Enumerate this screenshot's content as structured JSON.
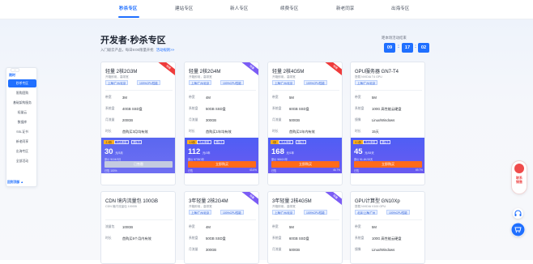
{
  "nav": {
    "tabs": [
      {
        "label": "秒杀专区",
        "active": true
      },
      {
        "label": "建站专区",
        "active": false
      },
      {
        "label": "新人专区",
        "active": false
      },
      {
        "label": "续费专区",
        "active": false
      },
      {
        "label": "新老同享",
        "active": false
      },
      {
        "label": "出海专区",
        "active": false
      }
    ]
  },
  "hero": {
    "title": "开发者·秒杀专区",
    "subtitle": "入门级云产品，每日9:00限量开抢",
    "link": "活动规则>>"
  },
  "countdown": {
    "label": "距本场活动结束",
    "h": "09",
    "m": "17",
    "s": "02"
  },
  "sidebar": {
    "dots": "···",
    "logo": "限时",
    "items": [
      "秒杀专区",
      "限购团购",
      "基础架构服务",
      "轻量云",
      "数据库",
      "SSL证书",
      "新老同享",
      "出海专区",
      "全部活动"
    ],
    "footer": "回到顶部 ▲"
  },
  "cards": [
    {
      "title": "轻量 2核2G3M",
      "desc": "开箱即用，高带宽",
      "chips": [
        "上海/广州/北京",
        "100%CPU性能"
      ],
      "ribbon": "特惠",
      "specs": [
        [
          "带宽",
          "3M"
        ],
        [
          "系统盘",
          "40GB SSD盘"
        ],
        [
          "月流量",
          "200GB"
        ],
        [
          "时长",
          "首购买3月均有效"
        ]
      ],
      "tags": [
        "2.3折",
        "个人专享",
        "限1个"
      ],
      "price": "30",
      "unit": "元/3月",
      "orig": "原价 ¥104/3月",
      "btn": "已售罄",
      "btn_disabled": true,
      "stock": "已售 100%",
      "stock_pct": ""
    },
    {
      "title": "轻量 2核2G4M",
      "desc": "开箱即用，高带宽",
      "chips": [
        "上海/广州/北京",
        "100%CPU性能"
      ],
      "ribbon": "限量",
      "specs": [
        [
          "带宽",
          "4M"
        ],
        [
          "系统盘",
          "50GB SSD盘"
        ],
        [
          "月流量",
          "300GB"
        ],
        [
          "时长",
          "首购买1年均有效"
        ]
      ],
      "tags": [
        "1.5折",
        "个人专享",
        "限1个"
      ],
      "price": "112",
      "unit": "元/1年",
      "orig": "原价 ¥735/1年",
      "btn": "立即购买",
      "btn_disabled": false,
      "stock": "已售",
      "stock_pct": "43.5%"
    },
    {
      "title": "轻量 2核4G5M",
      "desc": "开箱即用，高带宽",
      "chips": [
        "上海/广州/北京",
        "100%CPU性能"
      ],
      "ribbon": "特惠",
      "specs": [
        [
          "带宽",
          "5M"
        ],
        [
          "系统盘",
          "60GB SSD盘"
        ],
        [
          "月流量",
          "500GB"
        ],
        [
          "时长",
          "首购买1年内有效"
        ]
      ],
      "tags": [
        "2折",
        "个人专享",
        "限1个"
      ],
      "price": "168",
      "unit": "元/1年",
      "orig": "原价 ¥840/1年",
      "btn": "立即购买",
      "btn_disabled": false,
      "stock": "已售",
      "stock_pct": "46.7%"
    },
    {
      "title": "GPU服务器 GN7-T4",
      "desc": "搭载 NVIDIA T4 GPU",
      "chips": [
        "上海/广州/北京"
      ],
      "ribbon": "",
      "specs": [
        [
          "带宽",
          "5M"
        ],
        [
          "系统盘",
          "100G 高性能云硬盘"
        ],
        [
          "镜像",
          "Linux/Windows"
        ],
        [
          "时长",
          "15天"
        ]
      ],
      "tags": [
        "0.1折",
        "个人专享",
        "限1个"
      ],
      "price": "45",
      "unit": "元/15天",
      "orig": "原价 ¥1.4K/15天",
      "btn": "立即购买",
      "btn_disabled": false,
      "stock": "已售",
      "stock_pct": "69.7%"
    },
    {
      "title": "CDN 境内流量包 100GB",
      "desc": "CDN 境内流量包 100GB",
      "chips": [],
      "ribbon": "",
      "specs": [
        [
          "流量包",
          "100GB"
        ],
        [
          "时长",
          "首购买6个月内有效"
        ]
      ],
      "tags": [],
      "price": "",
      "unit": "",
      "orig": "",
      "btn": "",
      "btn_disabled": false,
      "stock": "",
      "stock_pct": ""
    },
    {
      "title": "3年轻量 2核2G4M",
      "desc": "开箱即用，高带宽",
      "chips": [
        "上海/广州/北京",
        "100%CPU性能"
      ],
      "ribbon": "限量",
      "specs": [
        [
          "带宽",
          "4M"
        ],
        [
          "系统盘",
          "50GB SSD盘"
        ],
        [
          "月流量",
          "300GB"
        ]
      ],
      "tags": [],
      "price": "",
      "unit": "",
      "orig": "",
      "btn": "",
      "btn_disabled": false,
      "stock": "",
      "stock_pct": ""
    },
    {
      "title": "3年轻量 2核4G5M",
      "desc": "开箱即用，高带宽",
      "chips": [
        "上海/广州/北京",
        "100%CPU性能"
      ],
      "ribbon": "限量",
      "specs": [
        [
          "带宽",
          "5M"
        ],
        [
          "系统盘",
          "60GB SSD盘"
        ],
        [
          "月流量",
          "500GB"
        ]
      ],
      "tags": [],
      "price": "",
      "unit": "",
      "orig": "",
      "btn": "",
      "btn_disabled": false,
      "stock": "",
      "stock_pct": ""
    },
    {
      "title": "GPU计算型 GN10Xp",
      "desc": "搭载 NVIDIA V100 GPU",
      "chips": [
        "北京/上海/广州",
        "100%CPU性能"
      ],
      "ribbon": "",
      "specs": [
        [
          "带宽",
          "5M"
        ],
        [
          "系统盘",
          "100G 高性能云硬盘"
        ],
        [
          "镜像",
          "Linux/Windows"
        ]
      ],
      "tags": [],
      "price": "",
      "unit": "",
      "orig": "",
      "btn": "",
      "btn_disabled": false,
      "stock": "",
      "stock_pct": ""
    }
  ],
  "rightbar": {
    "text": "联系销售"
  },
  "colors": {
    "accent": "#1f6fff",
    "buy": "#ff6a1a",
    "ribbon_red": "#ef3b3b",
    "ribbon_purple": "#7b5cf5"
  }
}
